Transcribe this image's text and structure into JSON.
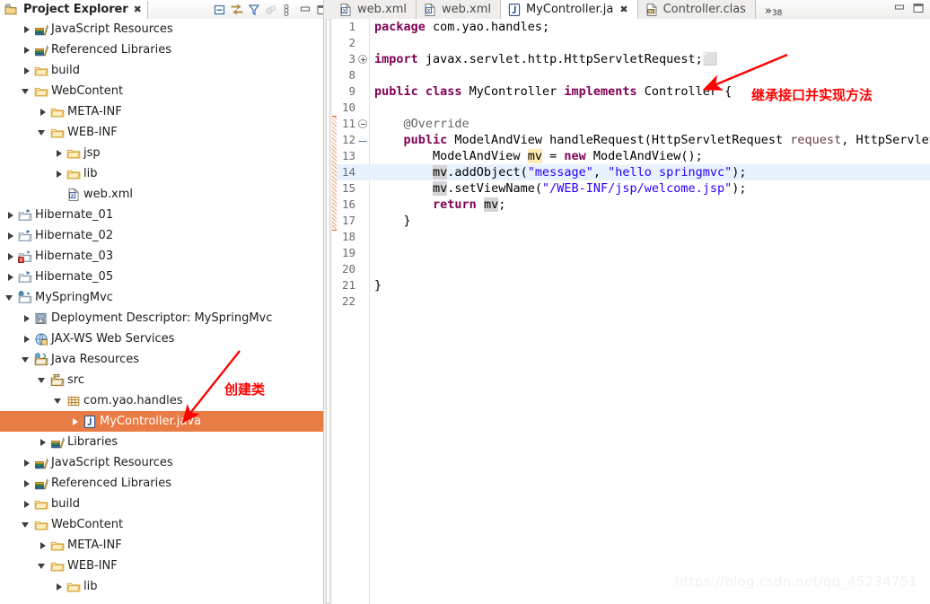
{
  "explorer": {
    "title": "Project Explorer",
    "close_glyph": "✖",
    "tools": [
      {
        "name": "collapse-all-icon",
        "title": "Collapse All"
      },
      {
        "name": "link-with-editor-icon",
        "title": "Link with Editor"
      },
      {
        "name": "filter-icon",
        "title": "Filters"
      },
      {
        "name": "focus-icon",
        "title": "Focus"
      },
      {
        "name": "view-menu-icon",
        "title": "View Menu"
      },
      {
        "name": "minimize-icon",
        "title": "Minimize"
      },
      {
        "name": "maximize-icon",
        "title": "Maximize"
      }
    ],
    "tree": [
      {
        "label": "JavaScript Resources",
        "depth": 1,
        "toggle": "right",
        "icon": "library-icon",
        "selected": false
      },
      {
        "label": "Referenced Libraries",
        "depth": 1,
        "toggle": "right",
        "icon": "library-icon",
        "selected": false
      },
      {
        "label": "build",
        "depth": 1,
        "toggle": "right",
        "icon": "folder-icon",
        "selected": false
      },
      {
        "label": "WebContent",
        "depth": 1,
        "toggle": "down",
        "icon": "folder-icon",
        "selected": false
      },
      {
        "label": "META-INF",
        "depth": 2,
        "toggle": "right",
        "icon": "folder-icon",
        "selected": false
      },
      {
        "label": "WEB-INF",
        "depth": 2,
        "toggle": "down",
        "icon": "folder-icon",
        "selected": false
      },
      {
        "label": "jsp",
        "depth": 3,
        "toggle": "right",
        "icon": "folder-icon",
        "selected": false
      },
      {
        "label": "lib",
        "depth": 3,
        "toggle": "right",
        "icon": "folder-icon",
        "selected": false
      },
      {
        "label": "web.xml",
        "depth": 3,
        "toggle": "none",
        "icon": "xml-file-icon",
        "selected": false
      },
      {
        "label": "Hibernate_01",
        "depth": 0,
        "toggle": "right",
        "icon": "project-icon",
        "selected": false
      },
      {
        "label": "Hibernate_02",
        "depth": 0,
        "toggle": "right",
        "icon": "project-icon",
        "selected": false
      },
      {
        "label": "Hibernate_03",
        "depth": 0,
        "toggle": "right",
        "icon": "project-error-icon",
        "selected": false
      },
      {
        "label": "Hibernate_05",
        "depth": 0,
        "toggle": "right",
        "icon": "project-icon",
        "selected": false
      },
      {
        "label": "MySpringMvc",
        "depth": 0,
        "toggle": "down",
        "icon": "web-project-icon",
        "selected": false
      },
      {
        "label": "Deployment Descriptor: MySpringMvc",
        "depth": 1,
        "toggle": "right",
        "icon": "deployment-descriptor-icon",
        "selected": false
      },
      {
        "label": "JAX-WS Web Services",
        "depth": 1,
        "toggle": "right",
        "icon": "webservice-icon",
        "selected": false
      },
      {
        "label": "Java Resources",
        "depth": 1,
        "toggle": "down",
        "icon": "java-resources-icon",
        "selected": false
      },
      {
        "label": "src",
        "depth": 2,
        "toggle": "down",
        "icon": "source-folder-icon",
        "selected": false
      },
      {
        "label": "com.yao.handles",
        "depth": 3,
        "toggle": "down",
        "icon": "package-icon",
        "selected": false
      },
      {
        "label": "MyController.java",
        "depth": 4,
        "toggle": "right",
        "icon": "java-file-icon",
        "selected": true
      },
      {
        "label": "Libraries",
        "depth": 2,
        "toggle": "right",
        "icon": "library-icon",
        "selected": false
      },
      {
        "label": "JavaScript Resources",
        "depth": 1,
        "toggle": "right",
        "icon": "library-icon",
        "selected": false
      },
      {
        "label": "Referenced Libraries",
        "depth": 1,
        "toggle": "right",
        "icon": "library-icon",
        "selected": false
      },
      {
        "label": "build",
        "depth": 1,
        "toggle": "right",
        "icon": "folder-icon",
        "selected": false
      },
      {
        "label": "WebContent",
        "depth": 1,
        "toggle": "down",
        "icon": "folder-icon",
        "selected": false
      },
      {
        "label": "META-INF",
        "depth": 2,
        "toggle": "right",
        "icon": "folder-icon",
        "selected": false
      },
      {
        "label": "WEB-INF",
        "depth": 2,
        "toggle": "down",
        "icon": "folder-icon",
        "selected": false
      },
      {
        "label": "lib",
        "depth": 3,
        "toggle": "right",
        "icon": "folder-icon",
        "selected": false
      }
    ],
    "selection_color": "#E97C45"
  },
  "editor": {
    "tabs": [
      {
        "label": "web.xml",
        "icon": "xml-file-icon",
        "active": false,
        "closable": false
      },
      {
        "label": "web.xml",
        "icon": "xml-file-icon",
        "active": false,
        "closable": false
      },
      {
        "label": "MyController.ja",
        "icon": "java-file-icon",
        "active": true,
        "closable": true
      },
      {
        "label": "Controller.clas",
        "icon": "class-file-icon",
        "active": false,
        "closable": false
      }
    ],
    "overflow_label": "»",
    "overflow_count": "38",
    "close_glyph": "✖",
    "minimize_glyph": "minimize-icon",
    "maximize_glyph": "maximize-icon",
    "lines": [
      {
        "num": "1",
        "fold": "none",
        "changed": false,
        "highlight": false,
        "tokens": [
          {
            "t": "package ",
            "c": "kw"
          },
          {
            "t": "com.yao.handles;",
            "c": ""
          }
        ]
      },
      {
        "num": "2",
        "fold": "none",
        "changed": false,
        "highlight": false,
        "tokens": []
      },
      {
        "num": "3",
        "fold": "plus",
        "changed": false,
        "highlight": false,
        "tokens": [
          {
            "t": "import ",
            "c": "kw"
          },
          {
            "t": "javax.servlet.http.HttpServletRequest;",
            "c": ""
          },
          {
            "t": "⬜",
            "c": "ann"
          }
        ]
      },
      {
        "num": "8",
        "fold": "none",
        "changed": false,
        "highlight": false,
        "tokens": []
      },
      {
        "num": "9",
        "fold": "none",
        "changed": false,
        "highlight": false,
        "tokens": [
          {
            "t": "public class ",
            "c": "kw"
          },
          {
            "t": "MyController ",
            "c": ""
          },
          {
            "t": "implements ",
            "c": "kw"
          },
          {
            "t": "Controller {",
            "c": ""
          }
        ]
      },
      {
        "num": "10",
        "fold": "none",
        "changed": false,
        "highlight": false,
        "tokens": []
      },
      {
        "num": "11",
        "fold": "minus",
        "changed": true,
        "highlight": false,
        "tokens": [
          {
            "t": "    @Override",
            "c": "ann"
          }
        ]
      },
      {
        "num": "12",
        "fold": "tri",
        "changed": true,
        "highlight": false,
        "tokens": [
          {
            "t": "    ",
            "c": ""
          },
          {
            "t": "public ",
            "c": "kw"
          },
          {
            "t": "ModelAndView handleRequest(HttpServletRequest ",
            "c": ""
          },
          {
            "t": "request",
            "c": "par"
          },
          {
            "t": ", HttpServletR",
            "c": ""
          }
        ]
      },
      {
        "num": "13",
        "fold": "none",
        "changed": true,
        "highlight": false,
        "tokens": [
          {
            "t": "        ModelAndView ",
            "c": ""
          },
          {
            "t": "mv",
            "c": "locw"
          },
          {
            "t": " = ",
            "c": ""
          },
          {
            "t": "new ",
            "c": "kw"
          },
          {
            "t": "ModelAndView();",
            "c": ""
          }
        ]
      },
      {
        "num": "14",
        "fold": "none",
        "changed": true,
        "highlight": true,
        "tokens": [
          {
            "t": "        ",
            "c": ""
          },
          {
            "t": "mv",
            "c": "loc"
          },
          {
            "t": ".addObject(",
            "c": ""
          },
          {
            "t": "\"message\"",
            "c": "str"
          },
          {
            "t": ", ",
            "c": ""
          },
          {
            "t": "\"hello springmvc\"",
            "c": "str"
          },
          {
            "t": ");",
            "c": ""
          }
        ]
      },
      {
        "num": "15",
        "fold": "none",
        "changed": true,
        "highlight": false,
        "tokens": [
          {
            "t": "        ",
            "c": ""
          },
          {
            "t": "mv",
            "c": "loc"
          },
          {
            "t": ".setViewName(",
            "c": ""
          },
          {
            "t": "\"/WEB-INF/jsp/welcome.jsp\"",
            "c": "str"
          },
          {
            "t": ");",
            "c": ""
          }
        ]
      },
      {
        "num": "16",
        "fold": "none",
        "changed": true,
        "highlight": false,
        "tokens": [
          {
            "t": "        ",
            "c": ""
          },
          {
            "t": "return ",
            "c": "kw"
          },
          {
            "t": "mv",
            "c": "loc"
          },
          {
            "t": ";",
            "c": ""
          }
        ]
      },
      {
        "num": "17",
        "fold": "none",
        "changed": true,
        "highlight": false,
        "tokens": [
          {
            "t": "    }",
            "c": ""
          }
        ]
      },
      {
        "num": "18",
        "fold": "none",
        "changed": false,
        "highlight": false,
        "tokens": []
      },
      {
        "num": "19",
        "fold": "none",
        "changed": false,
        "highlight": false,
        "tokens": []
      },
      {
        "num": "20",
        "fold": "none",
        "changed": false,
        "highlight": false,
        "tokens": []
      },
      {
        "num": "21",
        "fold": "none",
        "changed": false,
        "highlight": false,
        "tokens": [
          {
            "t": "}",
            "c": ""
          }
        ]
      },
      {
        "num": "22",
        "fold": "none",
        "changed": false,
        "highlight": false,
        "tokens": []
      }
    ]
  },
  "annotations": {
    "code_note": "继承接口并实现方法",
    "tree_note": "创建类",
    "color": "#ff0000"
  },
  "watermark": "https://blog.csdn.net/qq_45234751"
}
